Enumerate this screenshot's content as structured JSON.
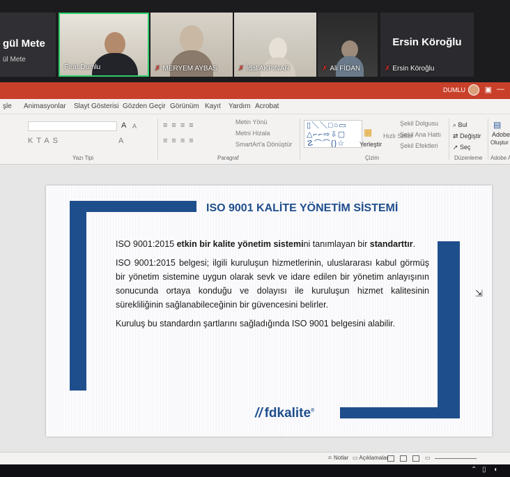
{
  "meeting": {
    "left_partial": {
      "name": "gül Mete",
      "subname": "ül Mete"
    },
    "participants": [
      {
        "name": "Fırat Dumlu"
      },
      {
        "name": "MERYEM AYBAS"
      },
      {
        "name": "İdal AKPINAR"
      },
      {
        "name": "Ali FİDAN"
      },
      {
        "name": "Ersin Köroğlu"
      }
    ],
    "name_card_big": "Ersin Köroğlu"
  },
  "powerpoint": {
    "user_label": "DUMLU",
    "tabs": [
      "şle",
      "Animasyonlar",
      "Slayt Gösterisi",
      "Gözden Geçir",
      "Görünüm",
      "Kayıt",
      "Yardım",
      "Acrobat"
    ],
    "ribbon": {
      "groups": [
        "Yazı Tipi",
        "Paragraf",
        "Çizim",
        "Düzenleme",
        "Adobe Acr"
      ],
      "arrange_label": "Yerleştir",
      "find_label": "Bul",
      "replace_label": "Değiştir",
      "select_label": "Seç",
      "adobe_label": "Adobe",
      "adobe_sub": "Oluştur ve",
      "font_size_grow": "A",
      "font_size_shrink": "A",
      "shape_fill": "Şekil Dolgusu",
      "shape_outline": "Şekil Ana Hattı",
      "shape_effects": "Şekil Efektleri",
      "quick_styles": "Hızlı Stiller",
      "text_direction": "Metin Yönü",
      "align_text": "Metni Hizala",
      "smartart": "SmartArt'a Dönüştür"
    },
    "status": {
      "notes": "Notlar",
      "comments": "Açıklamalar"
    }
  },
  "slide": {
    "title": "ISO 9001 KALİTE YÖNETİM SİSTEMİ",
    "p1_part1": "ISO 9001:2015 ",
    "p1_bold1": "etkin bir kalite yönetim sistemi",
    "p1_part2": "ni tanımlayan bir ",
    "p1_bold2": "standarttır",
    "p1_part3": ".",
    "p2": "ISO 9001:2015 belgesi; ilgili kuruluşun hizmetlerinin, uluslararası kabul görmüş bir yönetim sistemine uygun olarak sevk ve idare edilen bir yönetim anlayışının sonucunda ortaya konduğu ve dolayısı ile kuruluşun hizmet kalitesinin sürekliliğinin sağlanabileceğinin bir güvencesini belirler.",
    "p3": "Kuruluş bu standardın şartlarını sağladığında ISO 9001 belgesini alabilir.",
    "logo_text": "fdkalite",
    "logo_mark": "//",
    "logo_reg": "®"
  },
  "colors": {
    "accent": "#1f4e8c",
    "pp_red": "#c8402a",
    "active_speaker": "#2fcf6a"
  }
}
